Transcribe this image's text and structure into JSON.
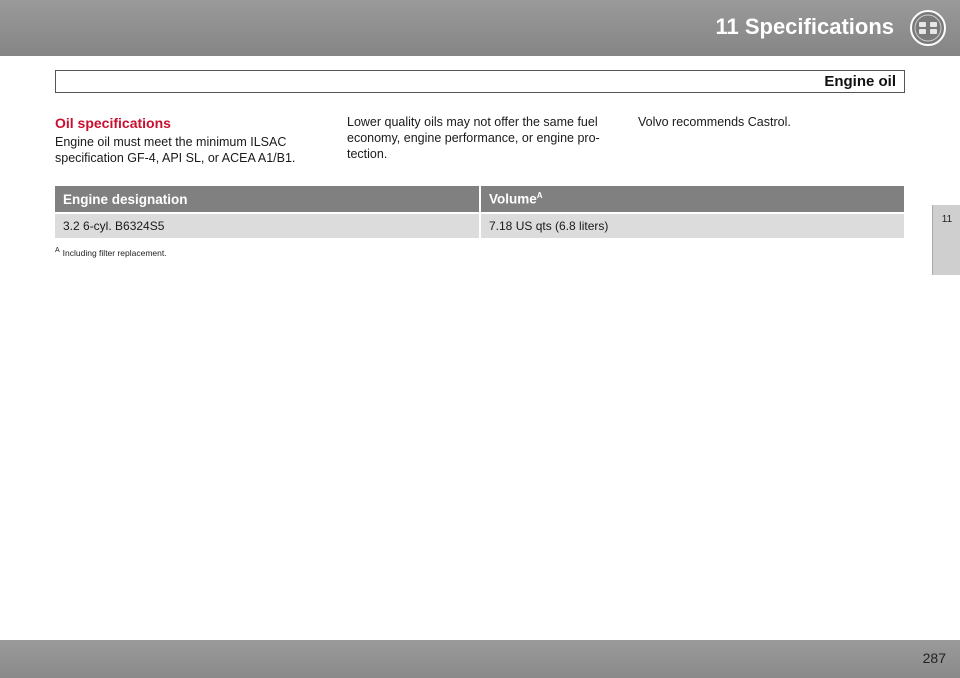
{
  "header": {
    "chapter_title": "11 Specifications",
    "chapter_icon": "specifications-icon"
  },
  "section": {
    "title": "Engine oil"
  },
  "side_tab": {
    "label": "11"
  },
  "content": {
    "heading": "Oil specifications",
    "col1_text": "Engine oil must meet the minimum ILSAC specification GF-4, API SL, or ACEA A1/B1.",
    "col2_text": "Lower quality oils may not offer the same fuel economy, engine performance, or engine pro-tection.",
    "col3_text": "Volvo recommends Castrol."
  },
  "table": {
    "headers": {
      "engine": "Engine designation",
      "volume": "Volume",
      "volume_note": "A"
    },
    "rows": [
      {
        "engine": "3.2 6-cyl. B6324S5",
        "volume": "7.18 US qts (6.8 liters)"
      }
    ]
  },
  "footnote": {
    "marker": "A",
    "text": "Including filter replacement."
  },
  "footer": {
    "page": "287"
  },
  "colors": {
    "header_bg": "#8f8f8f",
    "accent_red": "#c8102e",
    "table_header": "#808080",
    "table_row": "#dcdcdc"
  }
}
